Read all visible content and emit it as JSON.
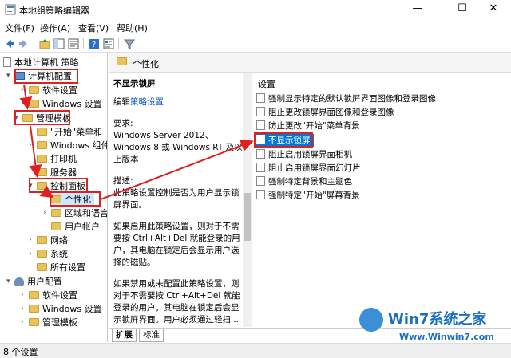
{
  "window": {
    "title": "本地组策略编辑器",
    "minimize": "—",
    "maximize": "☐",
    "close": "✕"
  },
  "menu": [
    "文件(F)",
    "操作(A)",
    "查看(V)",
    "帮助(H)"
  ],
  "tree": {
    "root": "本地计算机 策略",
    "computer_config": "计算机配置",
    "software_settings": "软件设置",
    "windows_settings": "Windows 设置",
    "admin_templates": "管理模板",
    "start_menu": "\"开始\"菜单和",
    "windows_components": "Windows 组件",
    "printers": "打印机",
    "servers": "服务器",
    "control_panel": "控制面板",
    "personalization": "个性化",
    "regional": "区域和语言",
    "user_accounts": "用户帐户",
    "network": "网络",
    "system": "系统",
    "all_settings": "所有设置",
    "user_config": "用户配置",
    "user_software_settings": "软件设置",
    "user_windows_settings": "Windows 设置",
    "user_admin_templates": "管理模板"
  },
  "right_header": "个性化",
  "description": {
    "title": "不显示锁屏",
    "edit_prefix": "编辑",
    "edit_link": "策略设置",
    "req_label": "要求:",
    "req_text": "Windows Server 2012、Windows 8 或 Windows RT 及以上版本",
    "desc_label": "描述:",
    "desc_text": "此策略设置控制是否为用户显示锁屏界面。",
    "enabled_text": "如果启用此策略设置，则对于不需要按 Ctrl+Alt+Del 就能登录的用户，其电脑在锁定后会显示用户选择的磁贴。",
    "disabled_text": "如果禁用或未配置此策略设置，则对于不需要按 Ctrl+Alt+Del 就能登录的用户，其电脑在锁定后会显示锁屏界面。用户必须通过轻扫..."
  },
  "settings": {
    "header": "设置",
    "items": [
      "强制显示特定的默认锁屏界面图像和登录图像",
      "阻止更改锁屏界面图像和登录图像",
      "防止更改\"开始\"菜单背景",
      "不显示锁屏",
      "阻止启用锁屏界面相机",
      "阻止启用锁屏界面幻灯片",
      "强制特定背景和主题色",
      "强制特定\"开始\"屏幕背景"
    ],
    "selected_index": 3
  },
  "tabs": [
    "扩展",
    "标准"
  ],
  "status": "8 个设置",
  "watermark": {
    "brand": "Win7系统之家",
    "url": "Www.Winwin7.com"
  },
  "colors": {
    "selection": "#0078d7",
    "annotation": "#e02020",
    "link": "#0b57d0"
  }
}
